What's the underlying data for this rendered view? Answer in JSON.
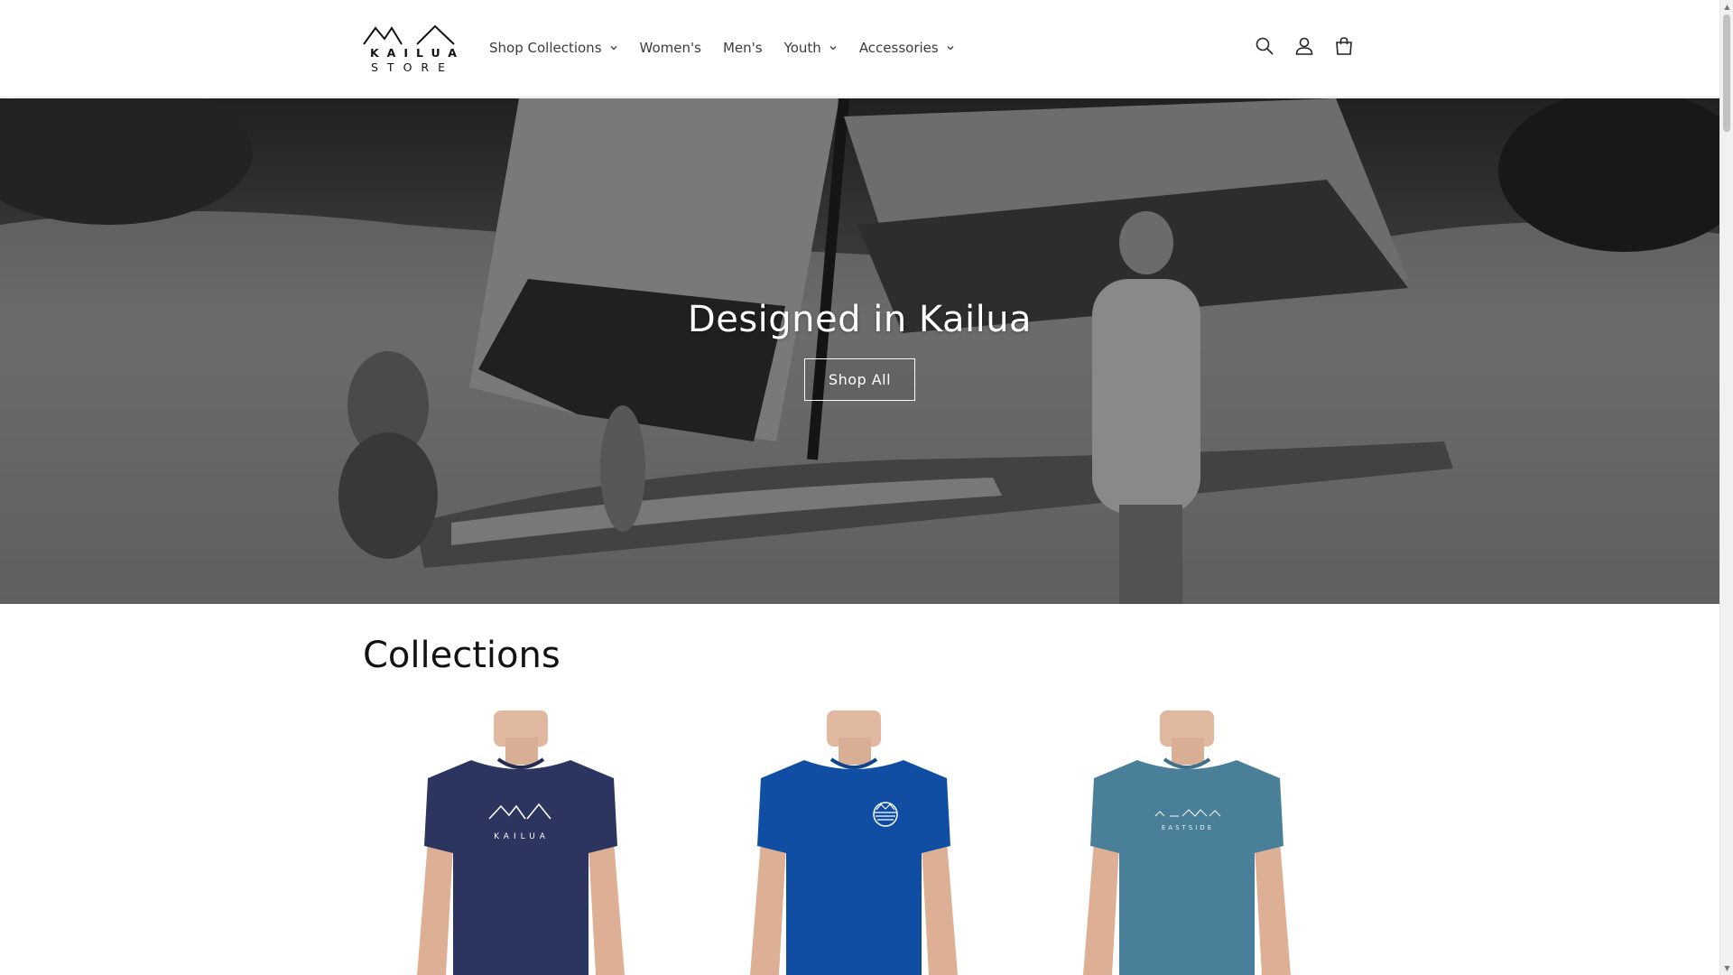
{
  "brand": {
    "line1": "KAILUA",
    "line2": "STORE"
  },
  "nav": {
    "items": [
      {
        "label": "Shop Collections",
        "has_dropdown": true
      },
      {
        "label": "Women's",
        "has_dropdown": false
      },
      {
        "label": "Men's",
        "has_dropdown": false
      },
      {
        "label": "Youth",
        "has_dropdown": true
      },
      {
        "label": "Accessories",
        "has_dropdown": true
      }
    ]
  },
  "header_icons": [
    "search-icon",
    "account-icon",
    "cart-icon"
  ],
  "hero": {
    "title": "Designed in Kailua",
    "button_label": "Shop All"
  },
  "collections": {
    "title": "Collections",
    "cards": [
      {
        "shirt_color": "#2b3560",
        "print": "KAILUA"
      },
      {
        "shirt_color": "#0f4ea3",
        "print": ""
      },
      {
        "shirt_color": "#4a7f99",
        "print": "EASTSIDE"
      }
    ]
  }
}
